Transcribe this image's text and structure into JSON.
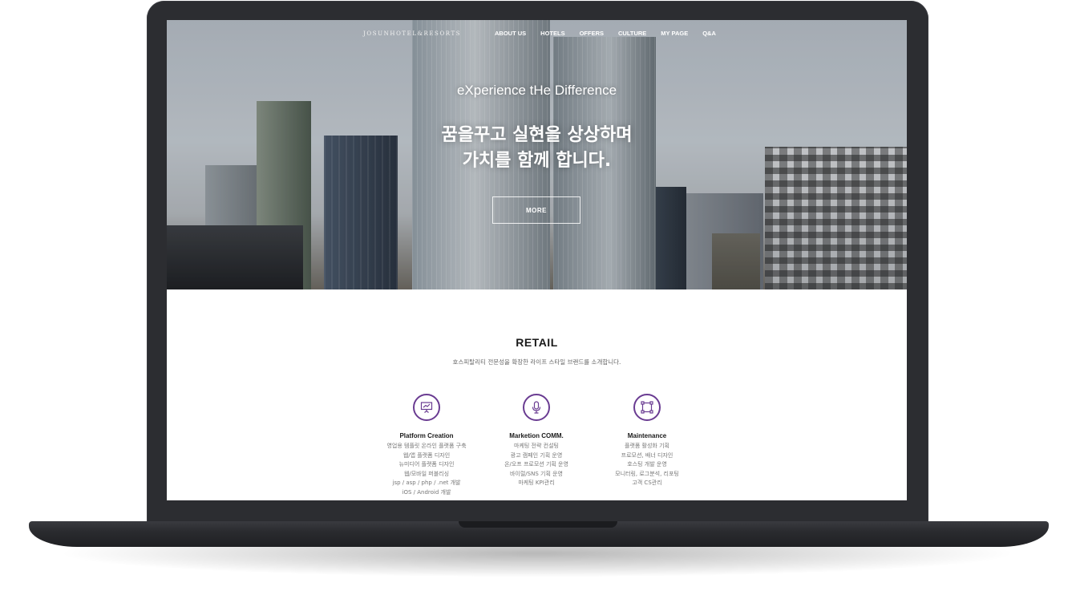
{
  "nav": {
    "logo": "JOSUNHOTEL&RESORTS",
    "items": [
      "ABOUT US",
      "HOTELS",
      "OFFERS",
      "CULTURE",
      "MY PAGE",
      "Q&A"
    ]
  },
  "hero": {
    "subtitle": "eXperience tHe Difference",
    "headline": [
      "꿈을꾸고 실현을 상상하며",
      "가치를 함께 합니다."
    ],
    "button": "MORE"
  },
  "retail": {
    "title": "RETAIL",
    "description": "호스피탈리티 전문성을 확장한 라이프 스타일 브랜드를 소개합니다.",
    "features": [
      {
        "icon": "presentation-icon",
        "title": "Platform Creation",
        "items": [
          "영업용 템플릿 온라인 플랫폼 구축",
          "웹/앱 플랫폼 디자인",
          "뉴미디어 플랫폼 디자인",
          "웹/모바일 퍼블리싱",
          "jsp / asp / php / .net 개발",
          "iOS / Android 개발",
          "..."
        ]
      },
      {
        "icon": "microphone-icon",
        "title": "Marketion COMM.",
        "items": [
          "마케팅 전략 컨설팅",
          "광고 캠페인 기획 운영",
          "온/오프 프로모션 기획 운영",
          "바이럴/SNS 기획 운영",
          "마케팅 KPI관리"
        ]
      },
      {
        "icon": "frame-icon",
        "title": "Maintenance",
        "items": [
          "플랫폼 활성화 기획",
          "프로모션, 배너 디자인",
          "호스팅 개발 운영",
          "모니터링, 로그분석, 리포팅",
          "고객 CS관리"
        ]
      }
    ]
  },
  "colors": {
    "accent": "#6a3c92",
    "laptop_body": "#2c2d31"
  }
}
